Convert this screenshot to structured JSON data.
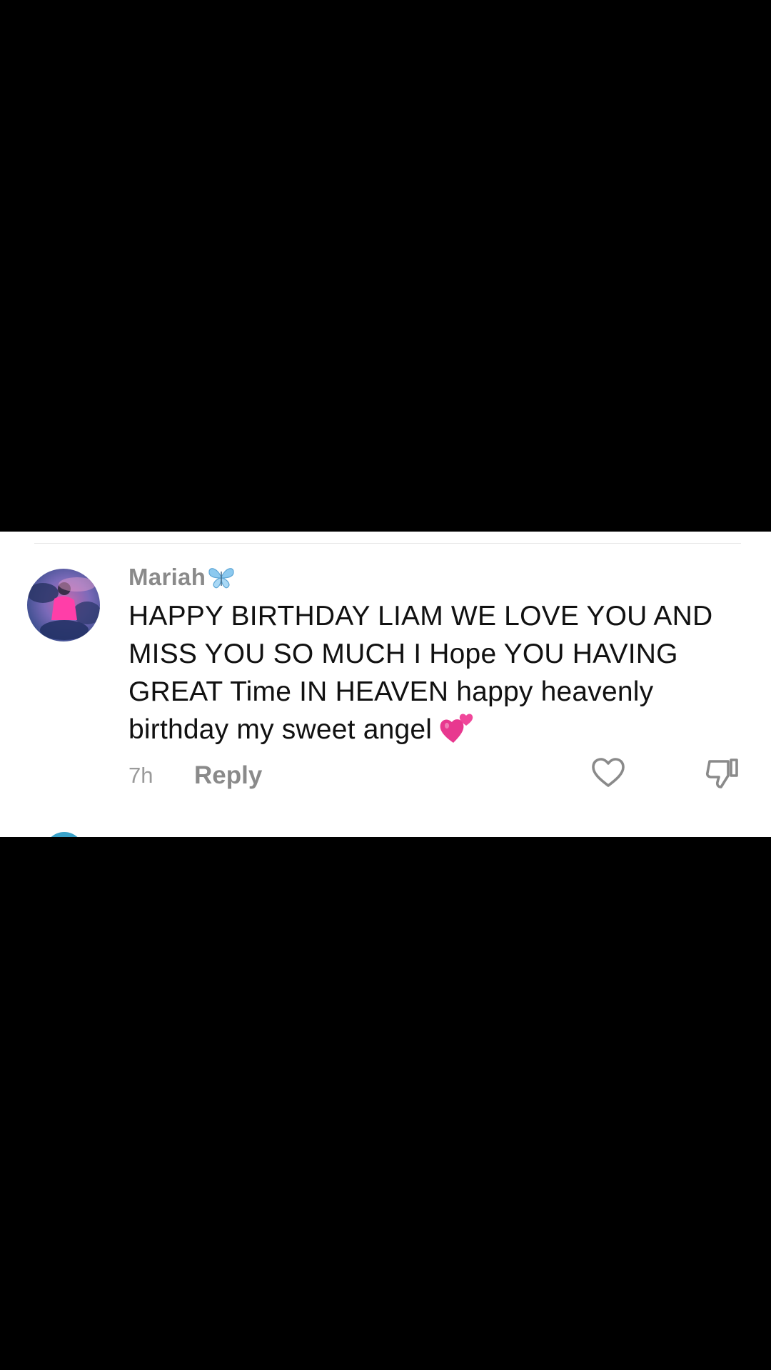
{
  "comment": {
    "username": "Mariah",
    "username_icon": "butterfly-icon",
    "text": "HAPPY BIRTHDAY LIAM WE LOVE YOU AND MISS YOU SO MUCH I Hope YOU HAVING GREAT Time IN HEAVEN happy heavenly birthday my sweet angel",
    "text_emoji": "two-hearts-icon",
    "time": "7h",
    "reply_label": "Reply",
    "like_icon": "heart-outline-icon",
    "dislike_icon": "thumbs-down-icon"
  },
  "colors": {
    "background_outer": "#000000",
    "panel": "#ffffff",
    "username": "#8a8a8a",
    "text": "#111111",
    "meta": "#9a9a9a",
    "emoji_pink": "#e8388f",
    "butterfly_blue": "#8cc9ef"
  }
}
